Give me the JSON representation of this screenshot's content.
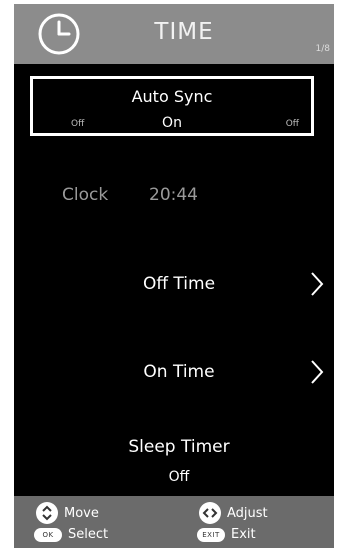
{
  "header": {
    "title": "TIME",
    "page_indicator": "1/8",
    "icon": "clock-icon"
  },
  "auto_sync": {
    "label": "Auto Sync",
    "prev_option": "Off",
    "current": "On",
    "next_option": "Off"
  },
  "clock": {
    "label": "Clock",
    "value": "20:44"
  },
  "menu": {
    "off_time": "Off Time",
    "on_time": "On Time",
    "sleep_timer": {
      "label": "Sleep Timer",
      "value": "Off"
    }
  },
  "footer": {
    "move": "Move",
    "adjust": "Adjust",
    "select": "Select",
    "exit": "Exit",
    "ok_key": "OK",
    "exit_key": "EXIT"
  },
  "colors": {
    "header_bg": "#8c8c8c",
    "panel_bg": "#000000",
    "footer_bg": "#6b6b6b",
    "dim_text": "#9a9a9a"
  }
}
